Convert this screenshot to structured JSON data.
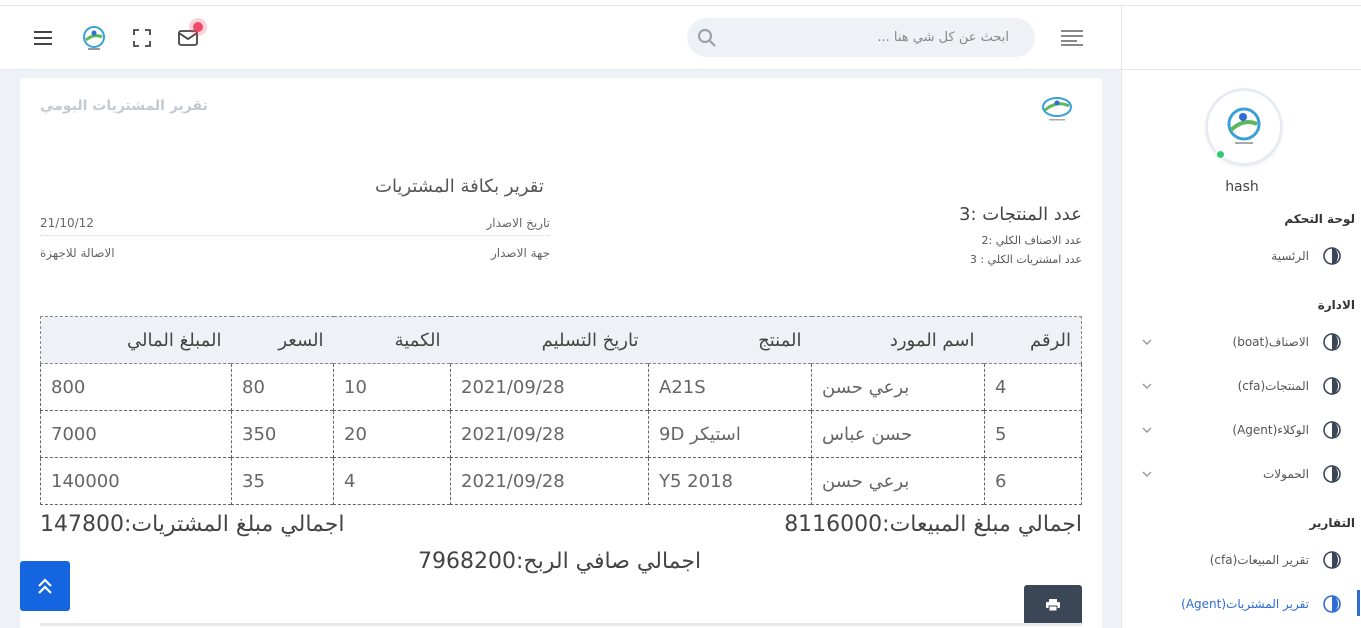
{
  "header": {
    "search_placeholder": "ابحث عن كل شي هنا ...",
    "icons": [
      "menu-icon",
      "logo-icon",
      "fullscreen-icon",
      "mail-icon",
      "search-icon",
      "sort-lines-icon"
    ],
    "notification_color": "#ef4a68"
  },
  "sidebar": {
    "username": "hash",
    "sections": {
      "dashboard": "لوحة التحكم",
      "admin": "الادارة",
      "reports": "التقارير"
    },
    "items": [
      {
        "label": "الرئسية",
        "icon": "globe-icon"
      },
      {
        "label": "الاصناف(boat)",
        "icon": "globe-icon",
        "has_children": true
      },
      {
        "label": "المنتجات(cfa)",
        "icon": "globe-icon",
        "has_children": true
      },
      {
        "label": "الوكلاء(Agent)",
        "icon": "globe-icon",
        "has_children": true
      },
      {
        "label": "الحمولات",
        "icon": "globe-icon",
        "has_children": true
      },
      {
        "label": "تقرير المبيعات(cfa)",
        "icon": "globe-icon"
      },
      {
        "label": "تقرير المشتريات(Agent)",
        "icon": "globe-icon",
        "active": true
      }
    ],
    "accent_color": "#2e6cd6"
  },
  "page": {
    "card_title": "تقرير المشتريات اليومي",
    "report_title": "تقرير بكافة المشتريات",
    "issue_date_label": "تاريخ الاصدار",
    "issue_date_value": "21/10/12",
    "issuer_label": "جهة الاصدار",
    "issuer_value": "الاصالة للاجهزة",
    "products_count": "عدد المنتجات :3",
    "categories_total": "عدد الاصناف الكلي :2",
    "purchases_total": "عدد امشتريات الكلي : 3"
  },
  "table": {
    "headers": [
      "الرقم",
      "اسم المورد",
      "المنتج",
      "تاريخ التسليم",
      "الكمية",
      "السعر",
      "المبلغ المالي"
    ],
    "rows": [
      [
        "4",
        "برعي حسن",
        "A21S",
        "2021/09/28",
        "10",
        "80",
        "800"
      ],
      [
        "5",
        "حسن عباس",
        "استيكر 9D",
        "2021/09/28",
        "20",
        "350",
        "7000"
      ],
      [
        "6",
        "برعي حسن",
        "Y5 2018",
        "2021/09/28",
        "4",
        "35",
        "140000"
      ]
    ]
  },
  "totals": {
    "sales": "اجمالي مبلغ المبيعات:8116000",
    "purchases": "اجمالي مبلغ المشتريات:147800",
    "net_profit": "اجمالي صافي الربح:7968200"
  },
  "buttons": {
    "print_icon": "printer-icon",
    "scroll_top_icon": "chevron-up-double-icon",
    "scroll_top_color": "#1565e0"
  }
}
